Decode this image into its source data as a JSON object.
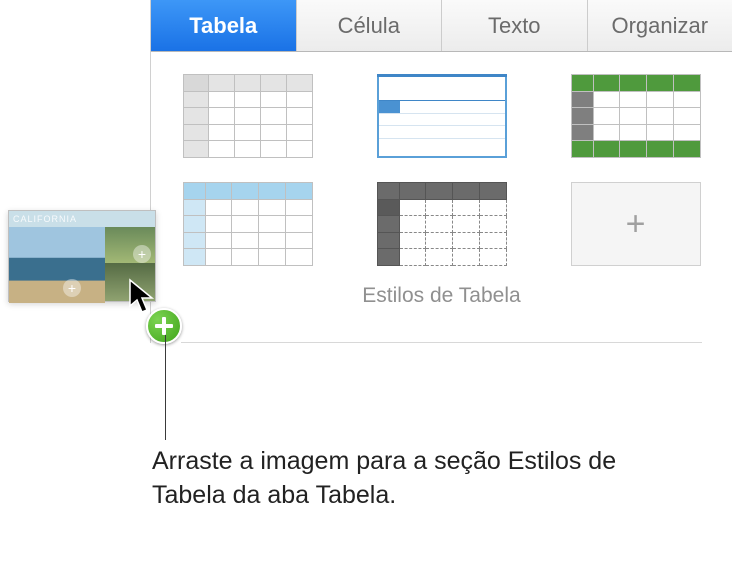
{
  "tabs": {
    "tabela": "Tabela",
    "celula": "Célula",
    "texto": "Texto",
    "organizar": "Organizar"
  },
  "section": {
    "styles_label": "Estilos de Tabela"
  },
  "drag_thumb": {
    "title": "CALIFORNIA"
  },
  "callout": {
    "text": "Arraste a imagem para a seção Estilos de Tabela da aba Tabela."
  },
  "icons": {
    "add": "plus-icon",
    "drop_badge": "green-plus-badge",
    "cursor": "arrow-cursor"
  }
}
